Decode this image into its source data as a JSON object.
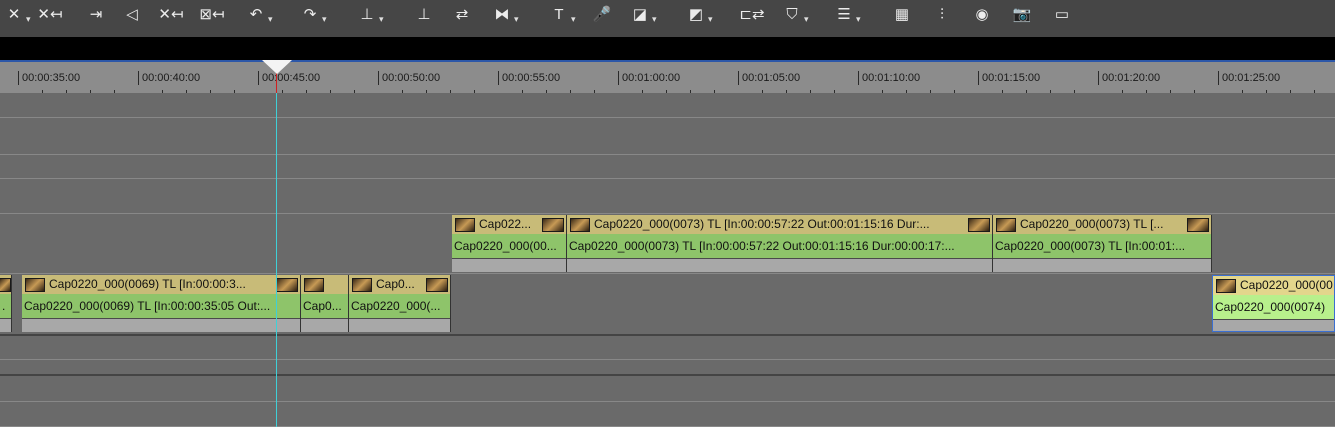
{
  "toolbar": {
    "buttons": [
      {
        "name": "delete-in-point-icon",
        "glyph": "✕",
        "dd": true
      },
      {
        "name": "delete-out-point-icon",
        "glyph": "✕↤",
        "dd": false
      },
      {
        "name": "set-in-out-icon",
        "glyph": "⇥",
        "dd": false
      },
      {
        "name": "clear-in-icon",
        "glyph": "◁",
        "dd": false
      },
      {
        "name": "clear-out-icon",
        "glyph": "✕↤",
        "dd": false
      },
      {
        "name": "clear-in-out-icon",
        "glyph": "⊠↤",
        "dd": false
      },
      {
        "name": "undo-icon",
        "glyph": "↶",
        "dd": true
      },
      {
        "name": "redo-icon",
        "glyph": "↷",
        "dd": true
      },
      {
        "name": "insert-icon",
        "glyph": "⊥",
        "dd": true
      },
      {
        "name": "overwrite-icon",
        "glyph": "⊥",
        "dd": false
      },
      {
        "name": "ripple-icon",
        "glyph": "⇄",
        "dd": false
      },
      {
        "name": "transition-icon",
        "glyph": "⧓",
        "dd": true
      },
      {
        "name": "title-icon",
        "glyph": "T",
        "dd": true
      },
      {
        "name": "microphone-icon",
        "glyph": "🎤",
        "dd": false
      },
      {
        "name": "fade-in-icon",
        "glyph": "◪",
        "dd": true
      },
      {
        "name": "fade-out-icon",
        "glyph": "◩",
        "dd": true
      },
      {
        "name": "link-icon",
        "glyph": "⊏⇄",
        "dd": false
      },
      {
        "name": "marker-icon",
        "glyph": "⛉",
        "dd": true
      },
      {
        "name": "track-color-icon",
        "glyph": "☰",
        "dd": true
      },
      {
        "name": "multicam-icon",
        "glyph": "▦",
        "dd": false
      },
      {
        "name": "mixer-icon",
        "glyph": "⫶",
        "dd": false
      },
      {
        "name": "color-wheel-icon",
        "glyph": "◉",
        "dd": false
      },
      {
        "name": "snapshot-icon",
        "glyph": "📷",
        "dd": false
      },
      {
        "name": "monitor-icon",
        "glyph": "▭",
        "dd": false
      }
    ]
  },
  "ruler": {
    "labels": [
      "|00:00:35:00",
      "|00:00:40:00",
      "|00:00:45:00",
      "|00:00:50:00",
      "|00:00:55:00",
      "|00:01:00:00",
      "|00:01:05:00",
      "|00:01:10:00",
      "|00:01:15:00",
      "|00:01:20:00",
      "|00:01:25:00"
    ]
  },
  "timeline": {
    "playhead_time": "00:00:45:00",
    "clips_upper": [
      {
        "top": "Cap022...",
        "bottom": "Cap0220_000(00..."
      },
      {
        "top": "Cap0220_000(0073)  TL [In:00:00:57:22 Out:00:01:15:16 Dur:...",
        "bottom": "Cap0220_000(0073)  TL [In:00:00:57:22 Out:00:01:15:16 Dur:00:00:17:..."
      },
      {
        "top": "Cap0220_000(0073)  TL [...",
        "bottom": "Cap0220_000(0073)  TL [In:00:01:..."
      }
    ],
    "clips_lower": [
      {
        "top": "",
        "bottom": "."
      },
      {
        "top": "Cap0220_000(0069)  TL [In:00:00:3...",
        "bottom": "Cap0220_000(0069)  TL [In:00:00:35:05 Out:..."
      },
      {
        "top": "",
        "bottom": "Cap0..."
      },
      {
        "top": "Cap0...",
        "bottom": "Cap0220_000(..."
      },
      {
        "top": "Cap0220_000(00",
        "bottom": "Cap0220_000(0074)"
      }
    ]
  }
}
